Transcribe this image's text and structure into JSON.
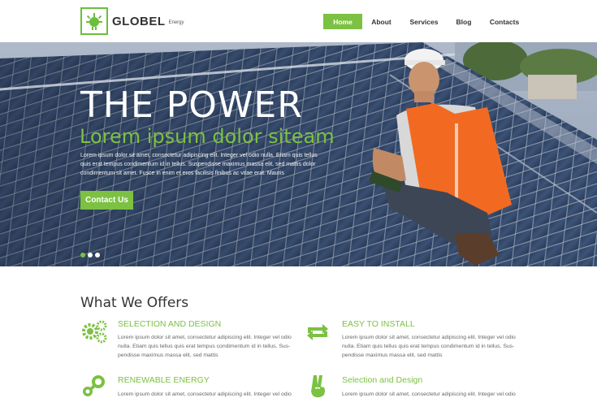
{
  "brand": {
    "name": "GLOBEL",
    "tagline": "Energy"
  },
  "nav": {
    "items": [
      {
        "label": "Home",
        "active": true
      },
      {
        "label": "About",
        "active": false
      },
      {
        "label": "Services",
        "active": false
      },
      {
        "label": "Blog",
        "active": false
      },
      {
        "label": "Contacts",
        "active": false
      }
    ]
  },
  "hero": {
    "title": "THE POWER",
    "subtitle": "Lorem ipsum dolor siteam",
    "text": "Lorem ipsum dolor sit amet, consectetur adipiscing elit. Integer vel odio nulla. Etiam quis tellus quis erat tempus condimentum id in tellus. Suspendisse maximus massa elit, sed mattis dolor condimentum sit amet. Fusce in enim et eros facilisis finibus ac vitae erat. Mauris",
    "button_label": "Contact Us",
    "slides": 3,
    "active_slide": 1
  },
  "offers": {
    "title": "What We Offers",
    "items": [
      {
        "heading": "SELECTION AND DESIGN",
        "icon": "gears-icon",
        "text": "Lorem ipsum dolor sit amet, consectetur adipiscing elit. Integer vel odio nulla. Etiam quis tellus quis erat tempus condimentum id in tellus. Sus-pendisse maximus massa elit, sed mattis"
      },
      {
        "heading": "EASY TO INSTALL",
        "icon": "repeat-arrows-icon",
        "text": "Lorem ipsum dolor sit amet, consectetur adipiscing elit. Integer vel odio nulla. Etiam quis tellus quis erat tempus condimentum id in tellus. Sus-pendisse maximus massa elit, sed mattis"
      },
      {
        "heading": "RENEWABLE ENERGY",
        "icon": "steam-icon",
        "text": "Lorem ipsum dolor sit amet, consectetur adipiscing elit. Integer vel odio"
      },
      {
        "heading": "Selection and Design",
        "icon": "peace-hand-icon",
        "text": "Lorem ipsum dolor sit amet, consectetur adipiscing elit. Integer vel odio"
      }
    ]
  },
  "colors": {
    "accent": "#7cc142",
    "text_dark": "#333333"
  }
}
